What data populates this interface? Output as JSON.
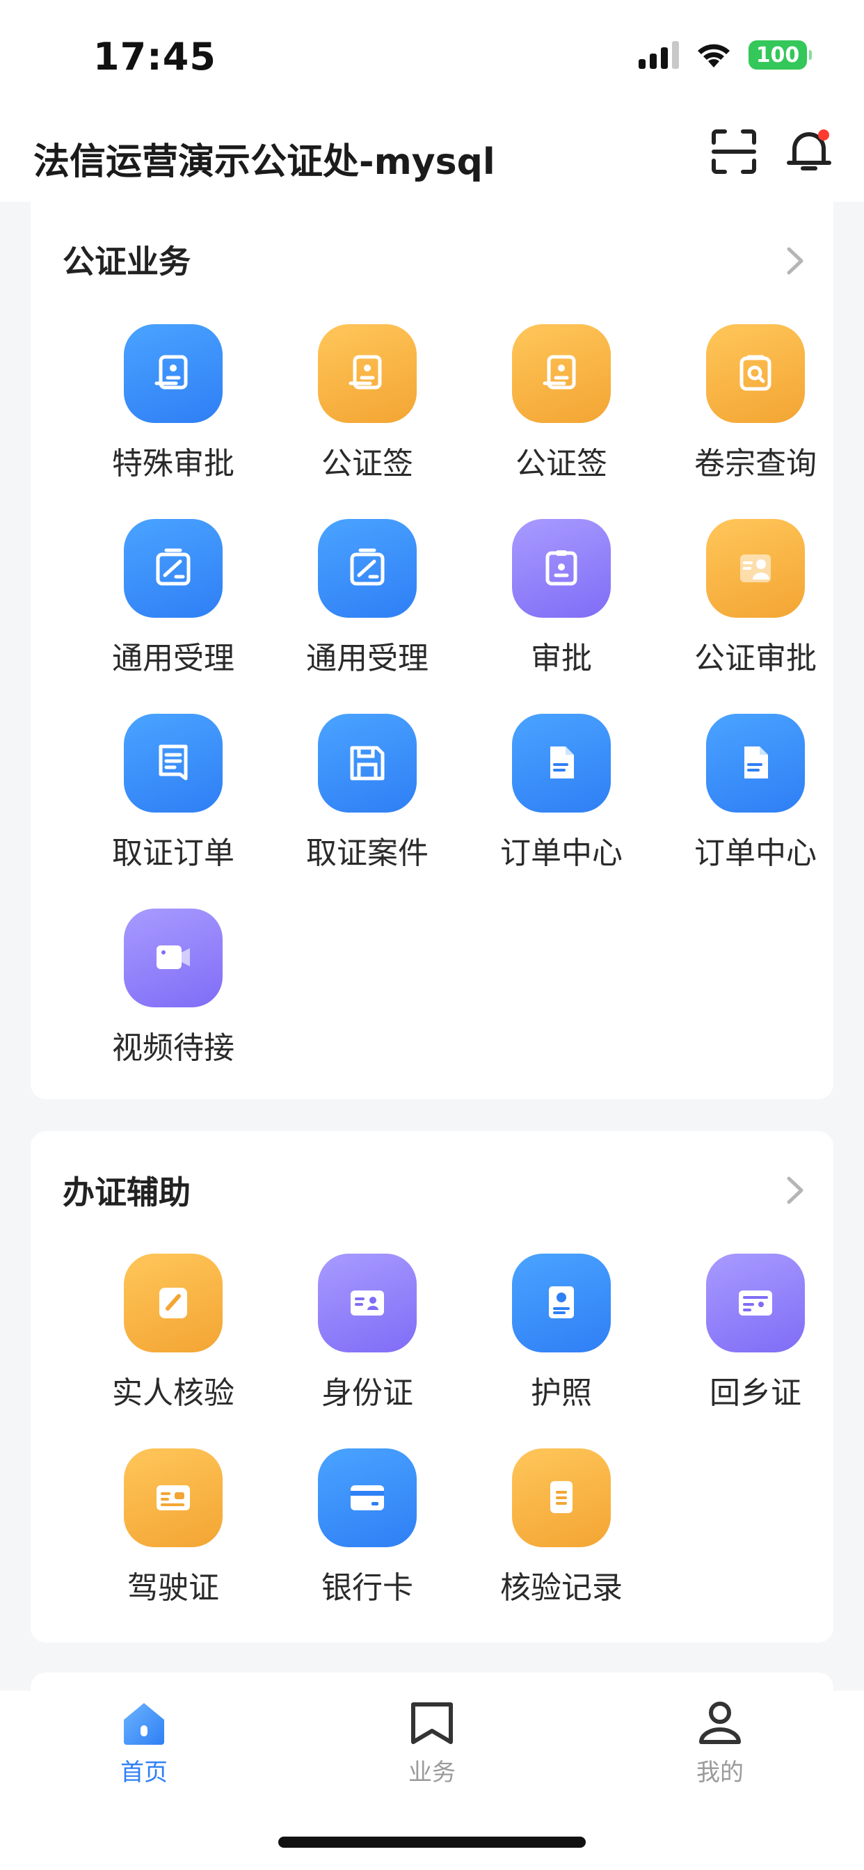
{
  "status_bar": {
    "time": "17:45",
    "battery": "100"
  },
  "header": {
    "title": "法信运营演示公证处-mysql"
  },
  "sections": {
    "notary": {
      "title": "公证业务",
      "items": [
        {
          "label": "特殊审批",
          "icon": "stamp-document-icon",
          "bg": "blue"
        },
        {
          "label": "公证签",
          "icon": "stamp-document-icon",
          "bg": "orange"
        },
        {
          "label": "公证签",
          "icon": "stamp-document-icon",
          "bg": "orange"
        },
        {
          "label": "卷宗查询",
          "icon": "search-file-icon",
          "bg": "orange"
        },
        {
          "label": "通用受理",
          "icon": "edit-board-icon",
          "bg": "blue"
        },
        {
          "label": "通用受理",
          "icon": "edit-board-icon",
          "bg": "blue"
        },
        {
          "label": "审批",
          "icon": "clipboard-person-icon",
          "bg": "purple"
        },
        {
          "label": "公证审批",
          "icon": "id-card-person-icon",
          "bg": "orange"
        },
        {
          "label": "取证订单",
          "icon": "document-list-icon",
          "bg": "blue"
        },
        {
          "label": "取证案件",
          "icon": "floppy-disk-icon",
          "bg": "blue"
        },
        {
          "label": "订单中心",
          "icon": "file-icon",
          "bg": "blue"
        },
        {
          "label": "订单中心",
          "icon": "file-icon",
          "bg": "blue"
        },
        {
          "label": "视频待接",
          "icon": "video-camera-icon",
          "bg": "purple"
        }
      ]
    },
    "assist": {
      "title": "办证辅助",
      "items": [
        {
          "label": "实人核验",
          "icon": "pen-note-icon",
          "bg": "orange"
        },
        {
          "label": "身份证",
          "icon": "id-card-icon",
          "bg": "purple"
        },
        {
          "label": "护照",
          "icon": "passport-icon",
          "bg": "blue"
        },
        {
          "label": "回乡证",
          "icon": "permit-card-icon",
          "bg": "purple"
        },
        {
          "label": "驾驶证",
          "icon": "driver-license-icon",
          "bg": "orange"
        },
        {
          "label": "银行卡",
          "icon": "bank-card-icon",
          "bg": "blue"
        },
        {
          "label": "核验记录",
          "icon": "record-note-icon",
          "bg": "orange"
        }
      ]
    }
  },
  "tabs": [
    {
      "label": "首页",
      "icon": "home-icon",
      "active": true
    },
    {
      "label": "业务",
      "icon": "bookmark-icon",
      "active": false
    },
    {
      "label": "我的",
      "icon": "person-icon",
      "active": false
    }
  ],
  "colors": {
    "accent": "#2f7ff5",
    "orange": "#f3a533",
    "purple": "#7f6df6",
    "notification": "#ff3b30"
  }
}
